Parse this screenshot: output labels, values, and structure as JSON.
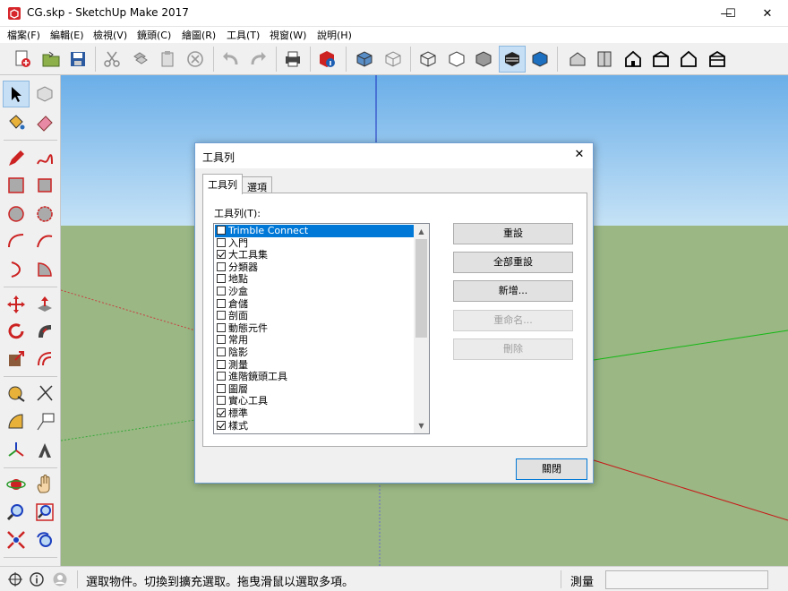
{
  "window": {
    "title": "CG.skp - SketchUp Make 2017",
    "minimize": "—",
    "maximize": "☐",
    "close": "✕"
  },
  "menu": [
    "檔案(F)",
    "編輯(E)",
    "檢視(V)",
    "鏡頭(C)",
    "繪圖(R)",
    "工具(T)",
    "視窗(W)",
    "說明(H)"
  ],
  "dialog": {
    "title": "工具列",
    "close": "✕",
    "tabs": [
      "工具列",
      "選項"
    ],
    "list_label": "工具列(T):",
    "items": [
      {
        "label": "Trimble Connect",
        "checked": false,
        "selected": true
      },
      {
        "label": "入門",
        "checked": false
      },
      {
        "label": "大工具集",
        "checked": true
      },
      {
        "label": "分類器",
        "checked": false
      },
      {
        "label": "地點",
        "checked": false
      },
      {
        "label": "沙盒",
        "checked": false
      },
      {
        "label": "倉儲",
        "checked": false
      },
      {
        "label": "剖面",
        "checked": false
      },
      {
        "label": "動態元件",
        "checked": false
      },
      {
        "label": "常用",
        "checked": false
      },
      {
        "label": "陰影",
        "checked": false
      },
      {
        "label": "測量",
        "checked": false
      },
      {
        "label": "進階鏡頭工具",
        "checked": false
      },
      {
        "label": "圖層",
        "checked": false
      },
      {
        "label": "實心工具",
        "checked": false
      },
      {
        "label": "標準",
        "checked": true
      },
      {
        "label": "樣式",
        "checked": true
      }
    ],
    "buttons": {
      "reset": "重設",
      "reset_all": "全部重設",
      "new": "新增...",
      "rename": "重命名...",
      "delete": "刪除",
      "close": "關閉"
    }
  },
  "status": {
    "message": "選取物件。切換到擴充選取。拖曳滑鼠以選取多項。",
    "measure_label": "測量",
    "measure_value": ""
  },
  "colors": {
    "sky": "#78b4e8",
    "ground": "#9ab784",
    "accent": "#0078d7"
  }
}
